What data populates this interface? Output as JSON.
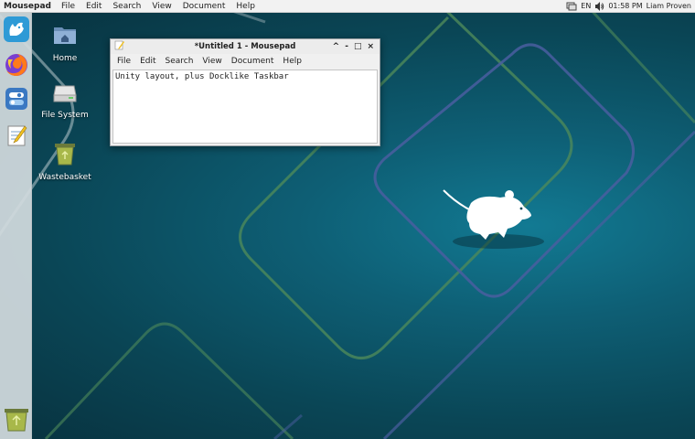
{
  "top_panel": {
    "app_name": "Mousepad",
    "menus": [
      "File",
      "Edit",
      "Search",
      "View",
      "Document",
      "Help"
    ],
    "tray": {
      "layout": "EN",
      "time": "01:58 PM",
      "user": "Liam Proven"
    }
  },
  "dock": {
    "items": [
      {
        "name": "whisker-menu-icon"
      },
      {
        "name": "firefox-icon"
      },
      {
        "name": "settings-toggle-icon"
      },
      {
        "name": "text-editor-icon"
      }
    ],
    "trash": {
      "name": "wastebasket-icon"
    }
  },
  "desktop_icons": [
    {
      "label": "Home",
      "icon": "home-folder-icon"
    },
    {
      "label": "File System",
      "icon": "drive-icon"
    },
    {
      "label": "Wastebasket",
      "icon": "trash-icon"
    }
  ],
  "window": {
    "title": "*Untitled 1 - Mousepad",
    "menus": [
      "File",
      "Edit",
      "Search",
      "View",
      "Document",
      "Help"
    ],
    "content": "Unity layout, plus Docklike Taskbar",
    "buttons": {
      "minimize": "^",
      "shade": "-",
      "maximize": "□",
      "close": "×"
    }
  },
  "colors": {
    "desktop": "#0c4a5c",
    "line_green": "#4e8a5a",
    "line_blue": "#4a5ea0",
    "line_gray": "#b8c8cc"
  }
}
